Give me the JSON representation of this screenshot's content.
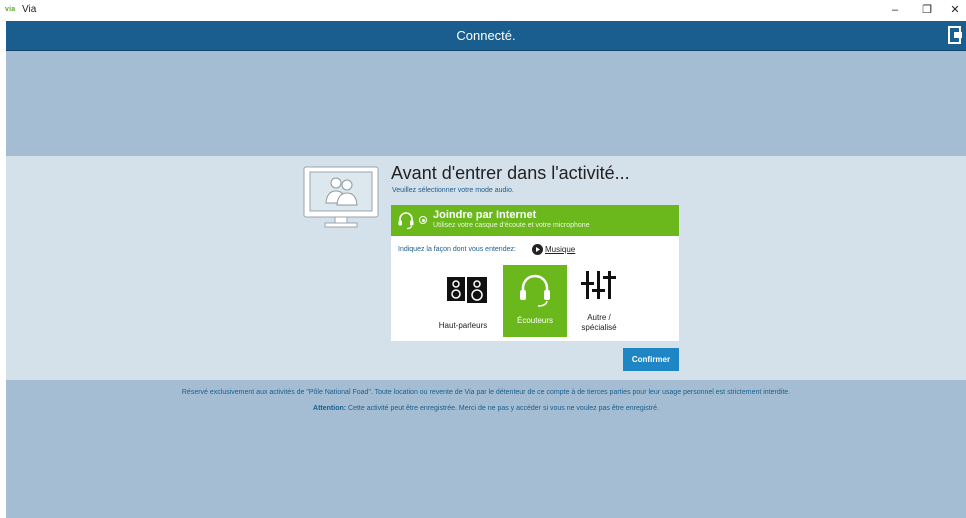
{
  "window": {
    "logo_text": "via",
    "title": "Via",
    "minimize_glyph": "–",
    "maximize_glyph": "❐",
    "close_glyph": "✕"
  },
  "header": {
    "status": "Connecté.",
    "exit_icon": "exit-door-icon"
  },
  "main": {
    "title": "Avant d'entrer dans l'activité...",
    "subtitle": "Veuillez sélectionner votre mode audio."
  },
  "audio_option": {
    "title": "Joindre par Internet",
    "description": "Utilisez votre casque d'écoute et votre microphone",
    "selected": true,
    "icon": "headset-icon"
  },
  "listening": {
    "hint": "Indiquez la façon dont vous entendez:",
    "music_link": "Musique",
    "choices": [
      {
        "label": "Haut-parleurs",
        "icon": "speakers-icon",
        "selected": false
      },
      {
        "label": "Écouteurs",
        "icon": "headphones-icon",
        "selected": true
      },
      {
        "label_line1": "Autre /",
        "label_line2": "spécialisé",
        "icon": "equalizer-icon",
        "selected": false
      }
    ]
  },
  "actions": {
    "confirm_label": "Confirmer"
  },
  "footer": {
    "notice": "Réservé exclusivement aux activités de \"Pôle National Foad\". Toute location ou revente de Via par le détenteur de ce compte à de tierces parties pour leur usage personnel est strictement interdite.",
    "warning_label": "Attention:",
    "warning_text": " Cette activité peut être enregistrée. Merci de ne pas y accéder si vous ne voulez pas être enregistré."
  },
  "colors": {
    "header": "#1a5e8f",
    "background": "#a4bdd2",
    "band": "#d4e0ea",
    "accent_green": "#6ab81c",
    "button_blue": "#1f86c6",
    "link_blue": "#1a5e8f"
  }
}
